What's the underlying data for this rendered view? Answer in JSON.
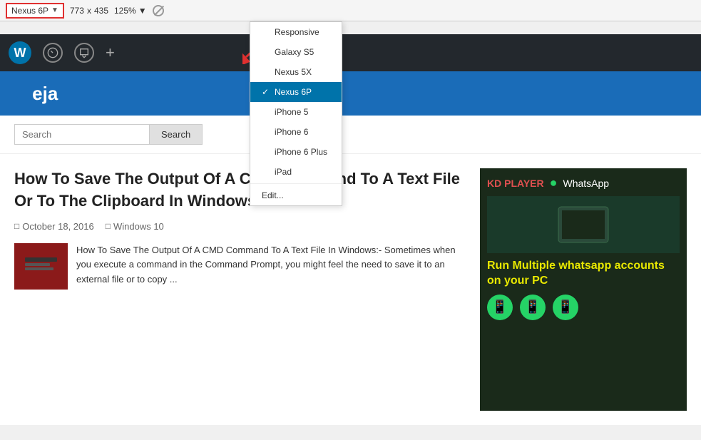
{
  "toolbar": {
    "device_label": "Nexus 6P",
    "dropdown_arrow": "▼",
    "width": "773",
    "x_separator": "x",
    "height": "435",
    "zoom": "125%",
    "zoom_arrow": "▼"
  },
  "dropdown": {
    "items": [
      {
        "id": "responsive",
        "label": "Responsive",
        "selected": false
      },
      {
        "id": "galaxy-s5",
        "label": "Galaxy S5",
        "selected": false
      },
      {
        "id": "nexus-5x",
        "label": "Nexus 5X",
        "selected": false
      },
      {
        "id": "nexus-6p",
        "label": "Nexus 6P",
        "selected": true
      },
      {
        "id": "iphone-5",
        "label": "iPhone 5",
        "selected": false
      },
      {
        "id": "iphone-6",
        "label": "iPhone 6",
        "selected": false
      },
      {
        "id": "iphone-6-plus",
        "label": "iPhone 6 Plus",
        "selected": false
      },
      {
        "id": "ipad",
        "label": "iPad",
        "selected": false
      }
    ],
    "edit_label": "Edit..."
  },
  "admin_bar": {
    "icons": [
      "wp-logo",
      "gauge-icon",
      "comment-icon",
      "plus-icon"
    ]
  },
  "site_header": {
    "title": "eja"
  },
  "search": {
    "placeholder": "Search",
    "button_label": "Search"
  },
  "article": {
    "title": "How To Save The Output Of A CMD Command To A Text File Or To The Clipboard In Windows",
    "date": "October 18, 2016",
    "category": "Windows 10",
    "preview_text": "How To Save The Output Of A CMD Command To A Text File In Windows:- Sometimes when you execute a command in the Command Prompt, you might feel the need to save it to an external file or to copy ..."
  },
  "ad": {
    "ldplayer": "KD PLAYER",
    "whatsapp": "WhatsApp",
    "headline": "Run Multiple whatsapp accounts on your PC"
  }
}
